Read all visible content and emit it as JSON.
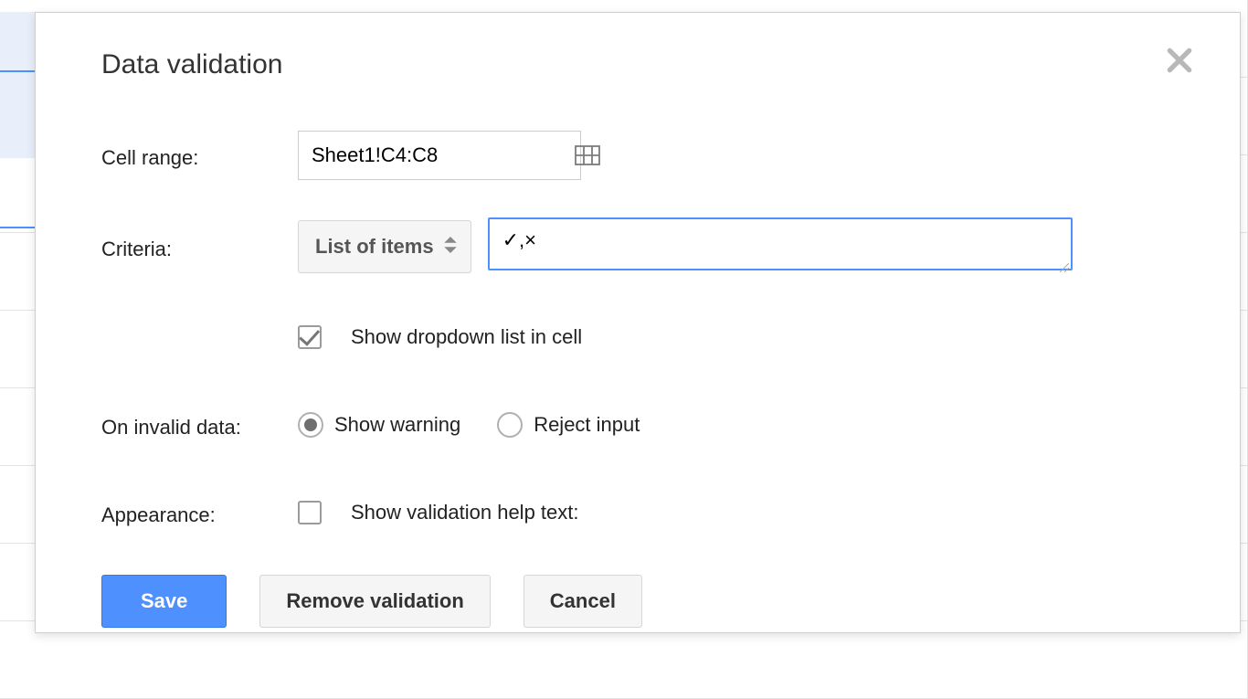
{
  "dialog": {
    "title": "Data validation",
    "labels": {
      "cell_range": "Cell range:",
      "criteria": "Criteria:",
      "on_invalid": "On invalid data:",
      "appearance": "Appearance:"
    },
    "cell_range_value": "Sheet1!C4:C8",
    "criteria_select": "List of items",
    "criteria_items_value": "✓,×",
    "show_dropdown_label": "Show dropdown list in cell",
    "show_dropdown_checked": true,
    "invalid_options": {
      "warning": "Show warning",
      "reject": "Reject input"
    },
    "invalid_selected": "warning",
    "appearance_checkbox_label": "Show validation help text:",
    "appearance_checked": false,
    "buttons": {
      "save": "Save",
      "remove": "Remove validation",
      "cancel": "Cancel"
    }
  }
}
